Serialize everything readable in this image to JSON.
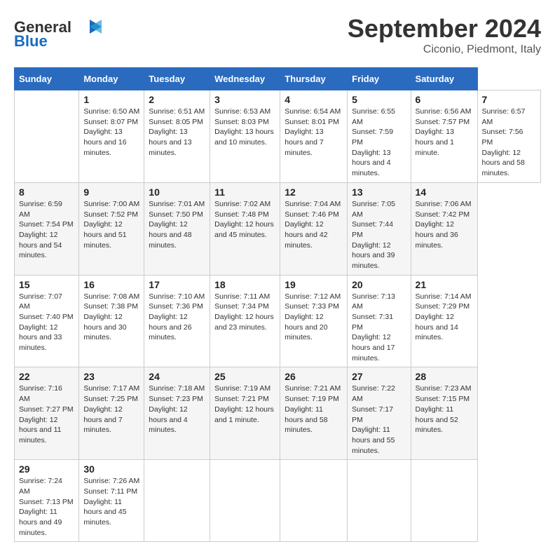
{
  "header": {
    "logo_text_general": "General",
    "logo_text_blue": "Blue",
    "month_title": "September 2024",
    "location": "Ciconio, Piedmont, Italy"
  },
  "calendar": {
    "days_of_week": [
      "Sunday",
      "Monday",
      "Tuesday",
      "Wednesday",
      "Thursday",
      "Friday",
      "Saturday"
    ],
    "weeks": [
      [
        null,
        {
          "day": "1",
          "sunrise": "Sunrise: 6:50 AM",
          "sunset": "Sunset: 8:07 PM",
          "daylight": "Daylight: 13 hours and 16 minutes."
        },
        {
          "day": "2",
          "sunrise": "Sunrise: 6:51 AM",
          "sunset": "Sunset: 8:05 PM",
          "daylight": "Daylight: 13 hours and 13 minutes."
        },
        {
          "day": "3",
          "sunrise": "Sunrise: 6:53 AM",
          "sunset": "Sunset: 8:03 PM",
          "daylight": "Daylight: 13 hours and 10 minutes."
        },
        {
          "day": "4",
          "sunrise": "Sunrise: 6:54 AM",
          "sunset": "Sunset: 8:01 PM",
          "daylight": "Daylight: 13 hours and 7 minutes."
        },
        {
          "day": "5",
          "sunrise": "Sunrise: 6:55 AM",
          "sunset": "Sunset: 7:59 PM",
          "daylight": "Daylight: 13 hours and 4 minutes."
        },
        {
          "day": "6",
          "sunrise": "Sunrise: 6:56 AM",
          "sunset": "Sunset: 7:57 PM",
          "daylight": "Daylight: 13 hours and 1 minute."
        },
        {
          "day": "7",
          "sunrise": "Sunrise: 6:57 AM",
          "sunset": "Sunset: 7:56 PM",
          "daylight": "Daylight: 12 hours and 58 minutes."
        }
      ],
      [
        {
          "day": "8",
          "sunrise": "Sunrise: 6:59 AM",
          "sunset": "Sunset: 7:54 PM",
          "daylight": "Daylight: 12 hours and 54 minutes."
        },
        {
          "day": "9",
          "sunrise": "Sunrise: 7:00 AM",
          "sunset": "Sunset: 7:52 PM",
          "daylight": "Daylight: 12 hours and 51 minutes."
        },
        {
          "day": "10",
          "sunrise": "Sunrise: 7:01 AM",
          "sunset": "Sunset: 7:50 PM",
          "daylight": "Daylight: 12 hours and 48 minutes."
        },
        {
          "day": "11",
          "sunrise": "Sunrise: 7:02 AM",
          "sunset": "Sunset: 7:48 PM",
          "daylight": "Daylight: 12 hours and 45 minutes."
        },
        {
          "day": "12",
          "sunrise": "Sunrise: 7:04 AM",
          "sunset": "Sunset: 7:46 PM",
          "daylight": "Daylight: 12 hours and 42 minutes."
        },
        {
          "day": "13",
          "sunrise": "Sunrise: 7:05 AM",
          "sunset": "Sunset: 7:44 PM",
          "daylight": "Daylight: 12 hours and 39 minutes."
        },
        {
          "day": "14",
          "sunrise": "Sunrise: 7:06 AM",
          "sunset": "Sunset: 7:42 PM",
          "daylight": "Daylight: 12 hours and 36 minutes."
        }
      ],
      [
        {
          "day": "15",
          "sunrise": "Sunrise: 7:07 AM",
          "sunset": "Sunset: 7:40 PM",
          "daylight": "Daylight: 12 hours and 33 minutes."
        },
        {
          "day": "16",
          "sunrise": "Sunrise: 7:08 AM",
          "sunset": "Sunset: 7:38 PM",
          "daylight": "Daylight: 12 hours and 30 minutes."
        },
        {
          "day": "17",
          "sunrise": "Sunrise: 7:10 AM",
          "sunset": "Sunset: 7:36 PM",
          "daylight": "Daylight: 12 hours and 26 minutes."
        },
        {
          "day": "18",
          "sunrise": "Sunrise: 7:11 AM",
          "sunset": "Sunset: 7:34 PM",
          "daylight": "Daylight: 12 hours and 23 minutes."
        },
        {
          "day": "19",
          "sunrise": "Sunrise: 7:12 AM",
          "sunset": "Sunset: 7:33 PM",
          "daylight": "Daylight: 12 hours and 20 minutes."
        },
        {
          "day": "20",
          "sunrise": "Sunrise: 7:13 AM",
          "sunset": "Sunset: 7:31 PM",
          "daylight": "Daylight: 12 hours and 17 minutes."
        },
        {
          "day": "21",
          "sunrise": "Sunrise: 7:14 AM",
          "sunset": "Sunset: 7:29 PM",
          "daylight": "Daylight: 12 hours and 14 minutes."
        }
      ],
      [
        {
          "day": "22",
          "sunrise": "Sunrise: 7:16 AM",
          "sunset": "Sunset: 7:27 PM",
          "daylight": "Daylight: 12 hours and 11 minutes."
        },
        {
          "day": "23",
          "sunrise": "Sunrise: 7:17 AM",
          "sunset": "Sunset: 7:25 PM",
          "daylight": "Daylight: 12 hours and 7 minutes."
        },
        {
          "day": "24",
          "sunrise": "Sunrise: 7:18 AM",
          "sunset": "Sunset: 7:23 PM",
          "daylight": "Daylight: 12 hours and 4 minutes."
        },
        {
          "day": "25",
          "sunrise": "Sunrise: 7:19 AM",
          "sunset": "Sunset: 7:21 PM",
          "daylight": "Daylight: 12 hours and 1 minute."
        },
        {
          "day": "26",
          "sunrise": "Sunrise: 7:21 AM",
          "sunset": "Sunset: 7:19 PM",
          "daylight": "Daylight: 11 hours and 58 minutes."
        },
        {
          "day": "27",
          "sunrise": "Sunrise: 7:22 AM",
          "sunset": "Sunset: 7:17 PM",
          "daylight": "Daylight: 11 hours and 55 minutes."
        },
        {
          "day": "28",
          "sunrise": "Sunrise: 7:23 AM",
          "sunset": "Sunset: 7:15 PM",
          "daylight": "Daylight: 11 hours and 52 minutes."
        }
      ],
      [
        {
          "day": "29",
          "sunrise": "Sunrise: 7:24 AM",
          "sunset": "Sunset: 7:13 PM",
          "daylight": "Daylight: 11 hours and 49 minutes."
        },
        {
          "day": "30",
          "sunrise": "Sunrise: 7:26 AM",
          "sunset": "Sunset: 7:11 PM",
          "daylight": "Daylight: 11 hours and 45 minutes."
        },
        null,
        null,
        null,
        null,
        null
      ]
    ]
  }
}
